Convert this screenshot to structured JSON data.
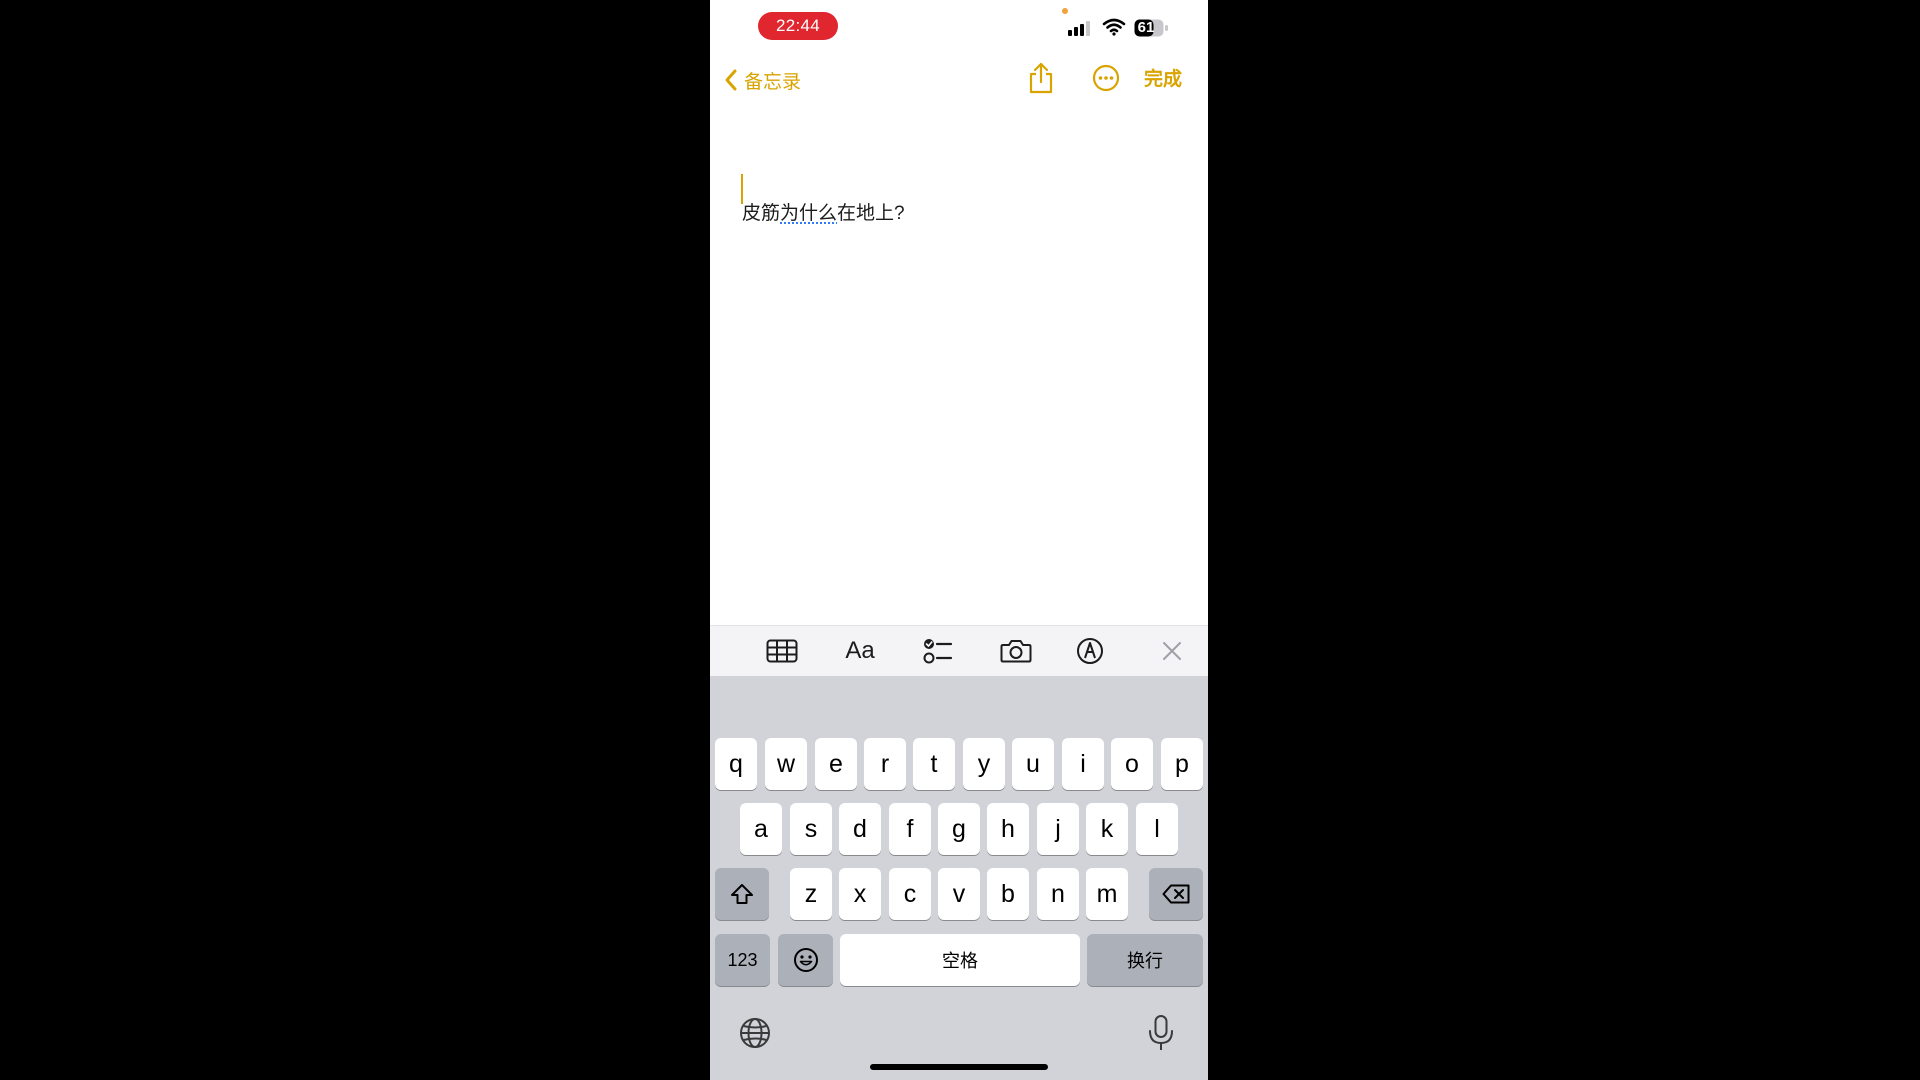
{
  "status_bar": {
    "time": "22:44",
    "battery": "61"
  },
  "nav": {
    "back_label": "备忘录",
    "done_label": "完成"
  },
  "note": {
    "segments": [
      "皮筋",
      "为什么",
      "在地上?"
    ]
  },
  "toolbar": {
    "format_label": "Aa"
  },
  "keyboard": {
    "row1": [
      "q",
      "w",
      "e",
      "r",
      "t",
      "y",
      "u",
      "i",
      "o",
      "p"
    ],
    "row2": [
      "a",
      "s",
      "d",
      "f",
      "g",
      "h",
      "j",
      "k",
      "l"
    ],
    "row3": [
      "z",
      "x",
      "c",
      "v",
      "b",
      "n",
      "m"
    ],
    "numbers_label": "123",
    "space_label": "空格",
    "return_label": "换行"
  },
  "colors": {
    "accent": "#d9a300",
    "recording_pill": "#e0262f",
    "keyboard_bg": "#d1d3d9",
    "spell_underline": "#2f7cf6"
  },
  "icons": [
    "chevron-left-icon",
    "share-icon",
    "more-icon",
    "table-icon",
    "checklist-icon",
    "camera-icon",
    "markup-icon",
    "close-icon",
    "shift-icon",
    "delete-icon",
    "emoji-icon",
    "globe-icon",
    "microphone-icon",
    "signal-icon",
    "wifi-icon",
    "battery-icon"
  ]
}
